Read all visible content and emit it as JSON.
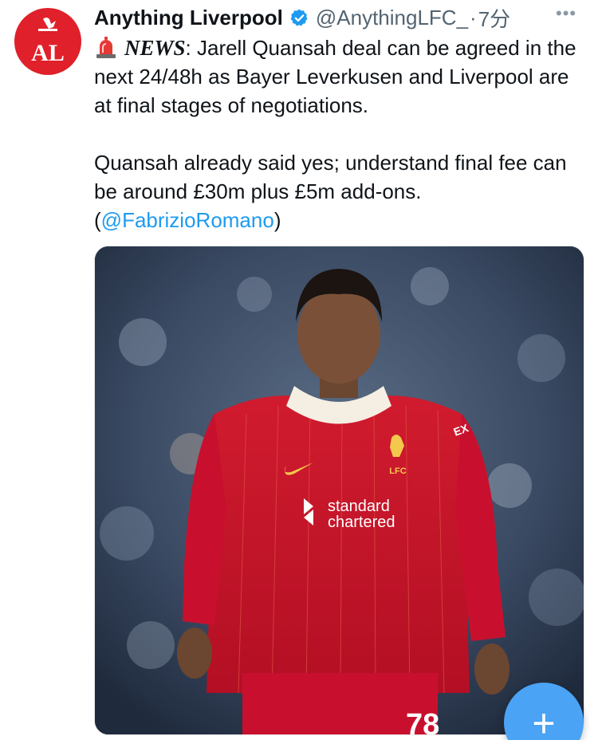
{
  "account": {
    "display_name": "Anything Liverpool",
    "handle": "@AnythingLFC_",
    "separator": "·",
    "time": "7分",
    "verified_icon": "verified-badge-icon",
    "avatar_text": "AL",
    "avatar_color": "#e0202a"
  },
  "more_label": "•••",
  "tweet": {
    "news_label": "NEWS",
    "line1_rest": ": Jarell Quansah deal can be agreed in the next 24/48h as Bayer Leverkusen and Liverpool are at final stages of negotiations.",
    "para2": "Quansah already said yes; understand final fee can be around £30m plus £5m add-ons.",
    "mention_open": "(",
    "mention": "@FabrizioRomano",
    "mention_close": ")"
  },
  "media": {
    "sponsor_line1": "standard",
    "sponsor_line2": "chartered",
    "crest_text": "LFC",
    "shirt_number": "78",
    "sleeve_text": "EX",
    "kit_color": "#c8102e"
  },
  "fab": {
    "label": "+",
    "icon": "compose-plus-icon",
    "color": "#4aa3f5"
  },
  "colors": {
    "link": "#1d9bf0",
    "muted": "#536471"
  }
}
